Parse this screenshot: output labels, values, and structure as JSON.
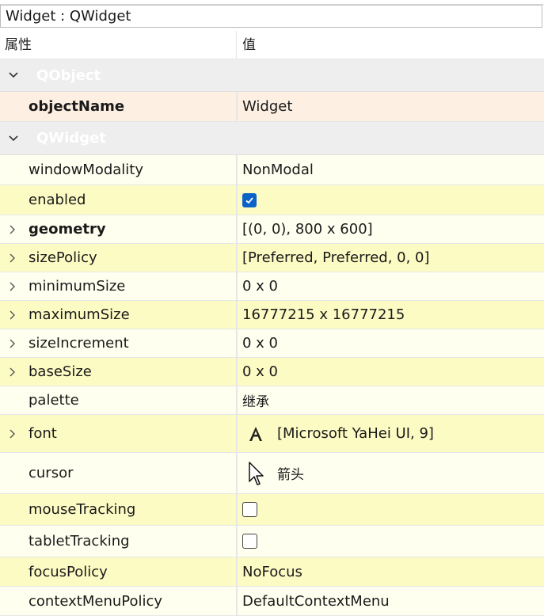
{
  "title_field": "Widget : QWidget",
  "header": {
    "property": "属性",
    "value": "值"
  },
  "groups": {
    "qobject": "QObject",
    "qwidget": "QWidget"
  },
  "rows": {
    "objectName": {
      "name": "objectName",
      "value": "Widget"
    },
    "windowModality": {
      "name": "windowModality",
      "value": "NonModal"
    },
    "enabled": {
      "name": "enabled",
      "checked": true
    },
    "geometry": {
      "name": "geometry",
      "value": "[(0, 0), 800 x 600]"
    },
    "sizePolicy": {
      "name": "sizePolicy",
      "value": "[Preferred, Preferred, 0, 0]"
    },
    "minimumSize": {
      "name": "minimumSize",
      "value": "0 x 0"
    },
    "maximumSize": {
      "name": "maximumSize",
      "value": "16777215 x 16777215"
    },
    "sizeIncrement": {
      "name": "sizeIncrement",
      "value": "0 x 0"
    },
    "baseSize": {
      "name": "baseSize",
      "value": "0 x 0"
    },
    "palette": {
      "name": "palette",
      "value": "继承"
    },
    "font": {
      "name": "font",
      "value": "[Microsoft YaHei UI, 9]",
      "icon": "font-A-icon"
    },
    "cursor": {
      "name": "cursor",
      "value": "箭头",
      "icon": "arrow-cursor-icon"
    },
    "mouseTracking": {
      "name": "mouseTracking",
      "checked": false
    },
    "tabletTracking": {
      "name": "tabletTracking",
      "checked": false
    },
    "focusPolicy": {
      "name": "focusPolicy",
      "value": "NoFocus"
    },
    "contextMenuPolicy": {
      "name": "contextMenuPolicy",
      "value": "DefaultContextMenu"
    }
  },
  "colors": {
    "group_bg": "#eeeeee",
    "object_row_bg": "#fdefe2",
    "widget_row_light": "#fffff0",
    "widget_row_dark": "#fdfbc4",
    "checkbox_checked": "#0a64c8"
  }
}
